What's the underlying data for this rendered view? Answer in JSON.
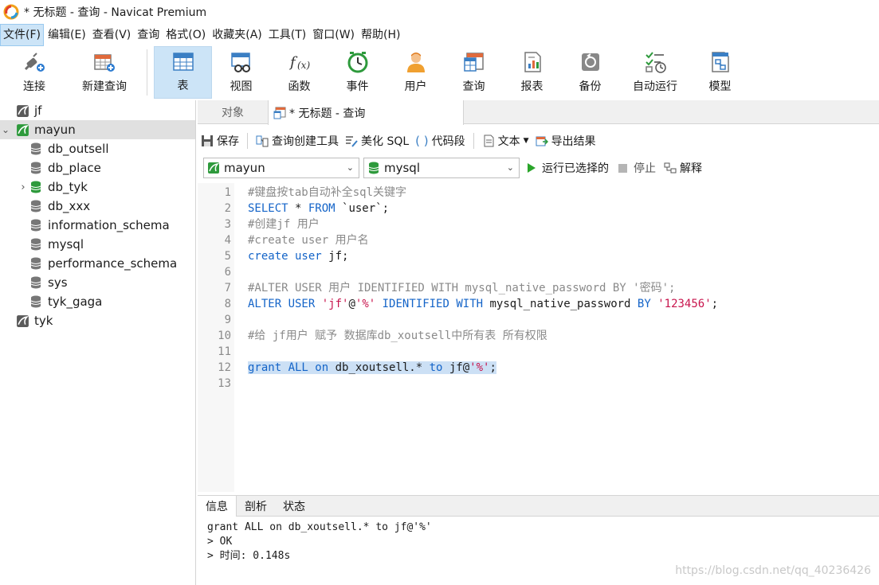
{
  "window": {
    "title": "* 无标题 - 查询 - Navicat Premium"
  },
  "menu": [
    {
      "label": "文件(F)",
      "active": true
    },
    {
      "label": "编辑(E)"
    },
    {
      "label": "查看(V)"
    },
    {
      "label": "查询"
    },
    {
      "label": "格式(O)"
    },
    {
      "label": "收藏夹(A)"
    },
    {
      "label": "工具(T)"
    },
    {
      "label": "窗口(W)"
    },
    {
      "label": "帮助(H)"
    }
  ],
  "toolbar": {
    "connect": "连接",
    "new_query": "新建查询",
    "table": "表",
    "view": "视图",
    "function": "函数",
    "event": "事件",
    "user": "用户",
    "query": "查询",
    "report": "报表",
    "backup": "备份",
    "auto_run": "自动运行",
    "model": "模型"
  },
  "sidebar": {
    "connections": [
      {
        "label": "jf"
      },
      {
        "label": "mayun",
        "selected": true
      },
      {
        "label": "tyk"
      }
    ],
    "databases": [
      {
        "label": "db_outsell"
      },
      {
        "label": "db_place"
      },
      {
        "label": "db_tyk",
        "expandable": true,
        "active": true
      },
      {
        "label": "db_xxx"
      },
      {
        "label": "information_schema"
      },
      {
        "label": "mysql"
      },
      {
        "label": "performance_schema"
      },
      {
        "label": "sys"
      },
      {
        "label": "tyk_gaga"
      }
    ]
  },
  "tabs": {
    "objects": "对象",
    "query": "* 无标题 - 查询"
  },
  "query_toolbar": {
    "save": "保存",
    "query_builder": "查询创建工具",
    "beautify": "美化 SQL",
    "snippet": "代码段",
    "text": "文本",
    "export": "导出结果"
  },
  "selectors": {
    "connection": "mayun",
    "database": "mysql",
    "run_selected": "运行已选择的",
    "stop": "停止",
    "explain": "解释"
  },
  "editor": {
    "line_numbers": [
      "1",
      "2",
      "3",
      "4",
      "5",
      "6",
      "7",
      "8",
      "9",
      "10",
      "11",
      "12",
      "13"
    ],
    "lines": {
      "l1": "#键盘按tab自动补全sql关键字",
      "l2_kw1": "SELECT",
      "l2_a": " * ",
      "l2_kw2": "FROM",
      "l2_b": " `user`;",
      "l3": "#创建jf 用户",
      "l4": "#create user 用户名",
      "l5_kw": "create user",
      "l5_b": " jf;",
      "l7": "#ALTER USER 用户 IDENTIFIED WITH mysql_native_password BY '密码';",
      "l8_kw1": "ALTER USER",
      "l8_s1": " 'jf'",
      "l8_at": "@",
      "l8_s2": "'%'",
      "l8_kw2": " IDENTIFIED WITH",
      "l8_b": " mysql_native_password ",
      "l8_kw3": "BY",
      "l8_s3": " '123456'",
      "l8_end": ";",
      "l10": "#给 jf用户 赋予 数据库db_xoutsell中所有表 所有权限",
      "l12_kw1": "grant ALL on",
      "l12_b": " db_xoutsell.* ",
      "l12_kw2": "to",
      "l12_c": " jf@",
      "l12_s": "'%'",
      "l12_end": ";"
    }
  },
  "result": {
    "tabs": [
      "信息",
      "剖析",
      "状态"
    ],
    "lines": [
      "grant ALL on db_xoutsell.* to jf@'%'",
      "> OK",
      "> 时间: 0.148s"
    ]
  },
  "watermark": "https://blog.csdn.net/qq_40236426",
  "colors": {
    "selection": "#cce4f7",
    "keyword": "#1464c8",
    "string": "#c8154d",
    "comment": "#8a8a8a"
  }
}
